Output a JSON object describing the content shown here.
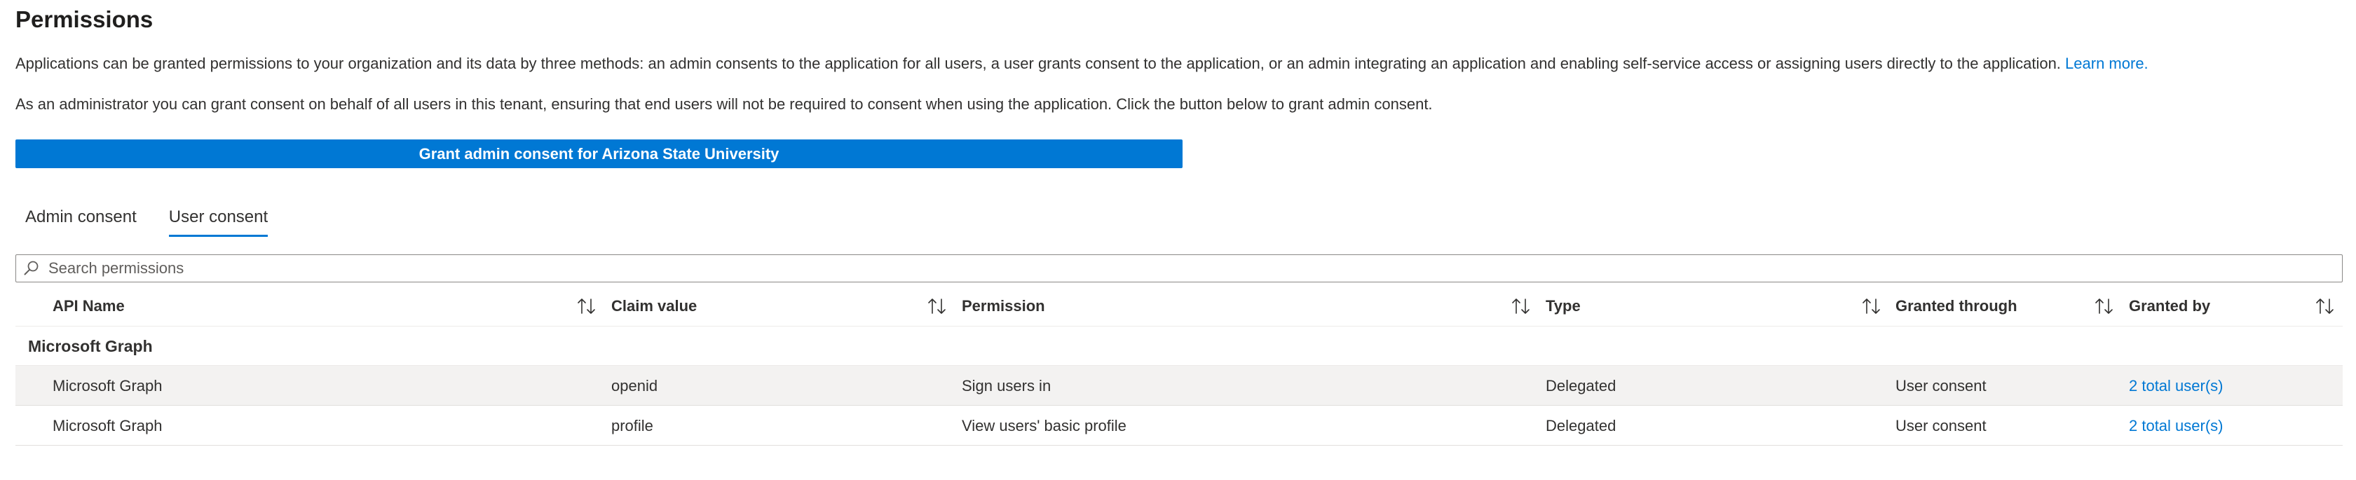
{
  "page": {
    "title": "Permissions",
    "description_1": "Applications can be granted permissions to your organization and its data by three methods: an admin consents to the application for all users, a user grants consent to the application, or an admin integrating an application and enabling self-service access or assigning users directly to the application.",
    "learn_more": "Learn more.",
    "description_2": "As an administrator you can grant consent on behalf of all users in this tenant, ensuring that end users will not be required to consent when using the application. Click the button below to grant admin consent.",
    "grant_button": "Grant admin consent for Arizona State University"
  },
  "tabs": [
    {
      "label": "Admin consent",
      "active": false
    },
    {
      "label": "User consent",
      "active": true
    }
  ],
  "search": {
    "placeholder": "Search permissions",
    "value": ""
  },
  "table": {
    "columns": [
      "API Name",
      "Claim value",
      "Permission",
      "Type",
      "Granted through",
      "Granted by"
    ],
    "group": "Microsoft Graph",
    "rows": [
      {
        "api_name": "Microsoft Graph",
        "claim_value": "openid",
        "permission": "Sign users in",
        "type": "Delegated",
        "granted_through": "User consent",
        "granted_by": "2 total user(s)"
      },
      {
        "api_name": "Microsoft Graph",
        "claim_value": "profile",
        "permission": "View users' basic profile",
        "type": "Delegated",
        "granted_through": "User consent",
        "granted_by": "2 total user(s)"
      }
    ]
  },
  "colors": {
    "accent": "#0078d4",
    "row_highlight": "#f3f2f1",
    "text": "#323130"
  },
  "icons": {
    "search": "search-icon",
    "sort": "sort-icon"
  }
}
